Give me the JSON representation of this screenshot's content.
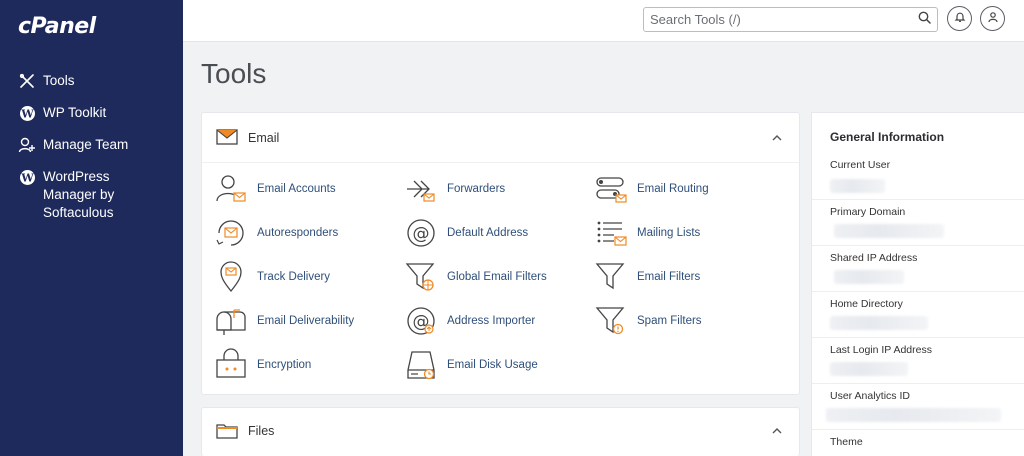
{
  "app": {
    "logo": "cPanel"
  },
  "sidebar": {
    "items": [
      {
        "label": "Tools",
        "icon": "tools-icon"
      },
      {
        "label": "WP Toolkit",
        "icon": "wordpress-icon"
      },
      {
        "label": "Manage Team",
        "icon": "team-icon"
      },
      {
        "label": "WordPress Manager by Softaculous",
        "icon": "wordpress-icon"
      }
    ]
  },
  "topbar": {
    "search_placeholder": "Search Tools (/)",
    "icons": [
      "search-icon",
      "bell-icon",
      "user-icon"
    ]
  },
  "page": {
    "title": "Tools"
  },
  "email_section": {
    "title": "Email",
    "tools": [
      {
        "label": "Email Accounts",
        "icon": "email-accounts-icon"
      },
      {
        "label": "Forwarders",
        "icon": "forwarders-icon"
      },
      {
        "label": "Email Routing",
        "icon": "email-routing-icon"
      },
      {
        "label": "Autoresponders",
        "icon": "autoresponders-icon"
      },
      {
        "label": "Default Address",
        "icon": "default-address-icon"
      },
      {
        "label": "Mailing Lists",
        "icon": "mailing-lists-icon"
      },
      {
        "label": "Track Delivery",
        "icon": "track-delivery-icon"
      },
      {
        "label": "Global Email Filters",
        "icon": "global-email-filters-icon"
      },
      {
        "label": "Email Filters",
        "icon": "email-filters-icon"
      },
      {
        "label": "Email Deliverability",
        "icon": "email-deliverability-icon"
      },
      {
        "label": "Address Importer",
        "icon": "address-importer-icon"
      },
      {
        "label": "Spam Filters",
        "icon": "spam-filters-icon"
      },
      {
        "label": "Encryption",
        "icon": "encryption-icon"
      },
      {
        "label": "Email Disk Usage",
        "icon": "email-disk-usage-icon"
      }
    ]
  },
  "files_section": {
    "title": "Files"
  },
  "general_info": {
    "title": "General Information",
    "rows": [
      {
        "label": "Current User"
      },
      {
        "label": "Primary Domain"
      },
      {
        "label": "Shared IP Address"
      },
      {
        "label": "Home Directory"
      },
      {
        "label": "Last Login IP Address"
      },
      {
        "label": "User Analytics ID"
      },
      {
        "label": "Theme"
      }
    ]
  },
  "colors": {
    "sidebar_bg": "#1f2a5c",
    "accent_orange": "#f08a24",
    "link_blue": "#2f4f7a"
  }
}
